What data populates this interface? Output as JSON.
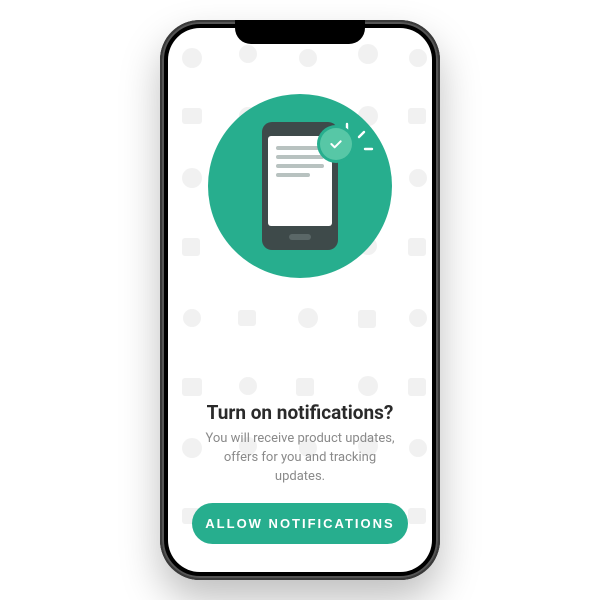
{
  "prompt": {
    "title": "Turn on notifications?",
    "description": "You will receive product updates, offers for you and tracking updates.",
    "cta_label": "ALLOW  NOTIFICATIONS"
  },
  "colors": {
    "accent": "#27ae8e",
    "accent_light": "#57c7a6"
  }
}
